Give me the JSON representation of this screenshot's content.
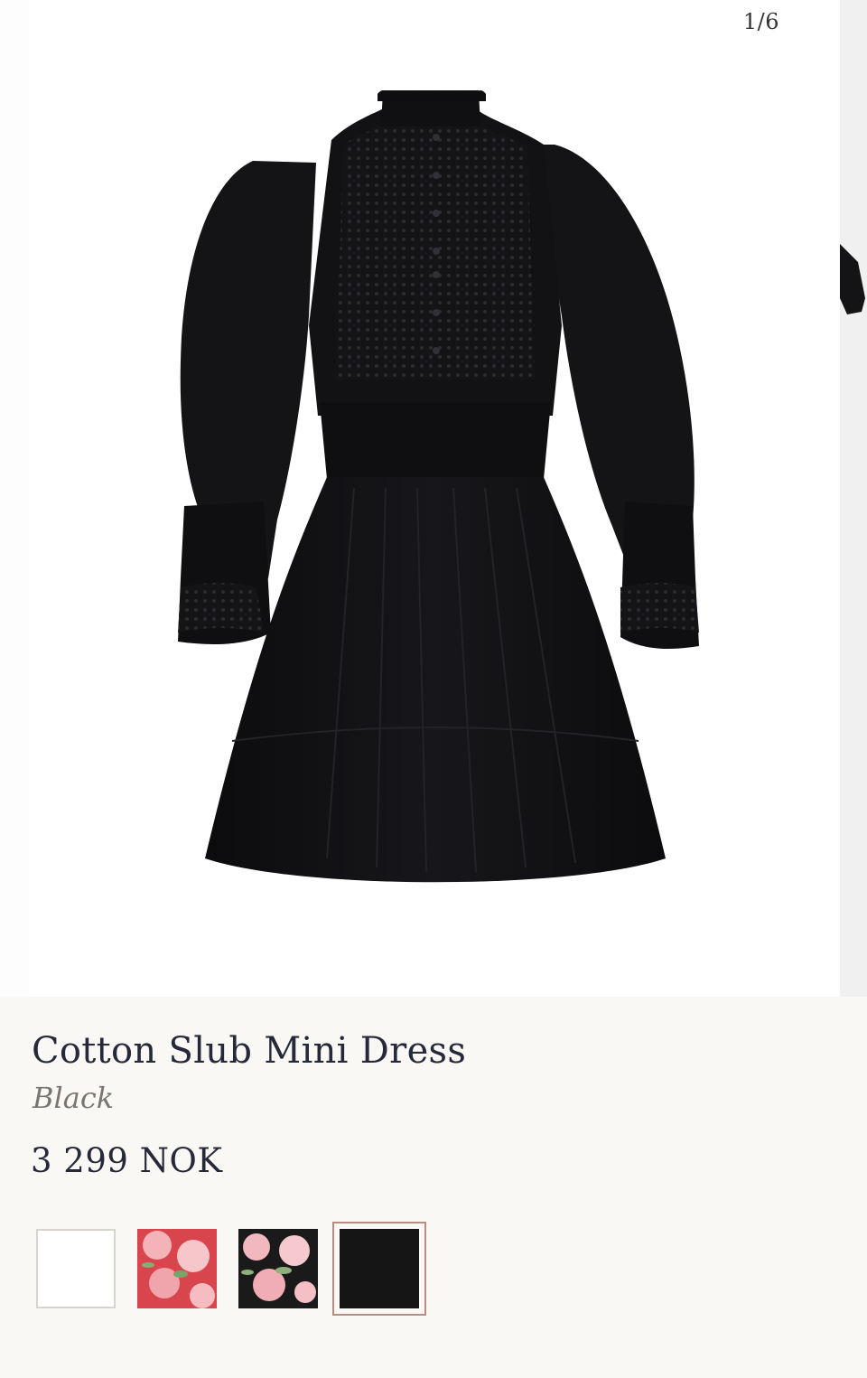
{
  "gallery": {
    "counter": "1/6",
    "image_alt": "Cotton Slub Mini Dress in Black, front view"
  },
  "product": {
    "name": "Cotton Slub Mini Dress",
    "color": "Black",
    "price": "3 299 NOK"
  },
  "swatches": [
    {
      "name": "White",
      "type": "solid",
      "color": "#ffffff",
      "selected": false
    },
    {
      "name": "Red floral",
      "type": "floral",
      "base": "#d8454d",
      "selected": false
    },
    {
      "name": "Black floral",
      "type": "floral",
      "base": "#1a1a1a",
      "selected": false
    },
    {
      "name": "Black",
      "type": "solid",
      "color": "#151515",
      "selected": true
    }
  ],
  "colors": {
    "background": "#faf8f4",
    "text": "#26293a",
    "muted": "#7a7571",
    "selected_border": "#b88e82",
    "dress": "#111114"
  }
}
